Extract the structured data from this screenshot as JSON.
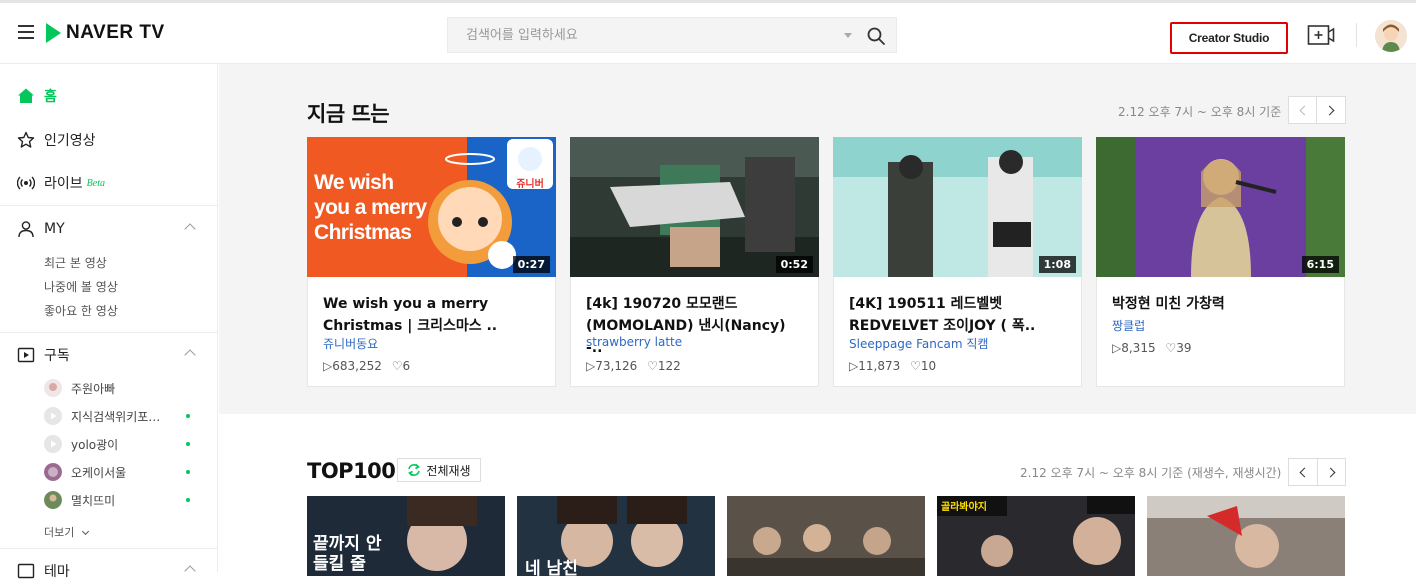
{
  "header": {
    "logo_text": "NAVER TV",
    "search_placeholder": "검색어를 입력하세요",
    "creator_studio_label": "Creator Studio",
    "accent_color": "#03c75a"
  },
  "sidebar": {
    "nav": [
      {
        "label": "홈",
        "icon": "home-icon",
        "active": true
      },
      {
        "label": "인기영상",
        "icon": "star-icon"
      },
      {
        "label": "라이브",
        "icon": "live-icon",
        "badge": "Beta"
      }
    ],
    "my": {
      "label": "MY",
      "items": [
        "최근 본 영상",
        "나중에 볼 영상",
        "좋아요 한 영상"
      ]
    },
    "subscriptions": {
      "label": "구독",
      "items": [
        {
          "name": "주원아빠",
          "new": false
        },
        {
          "name": "지식검색위키포…",
          "new": true
        },
        {
          "name": "yolo광이",
          "new": true
        },
        {
          "name": "오케이서울",
          "new": true
        },
        {
          "name": "멸치뜨미",
          "new": true
        }
      ],
      "more_label": "더보기"
    },
    "theme_label": "테마"
  },
  "trending": {
    "title": "지금 뜨는",
    "timestamp": "2.12 오후 7시 ~ 오후 8시 기준",
    "videos": [
      {
        "title": "We wish you a merry Christmas | 크리스마스 ..",
        "channel": "쥬니버동요",
        "views": "683,252",
        "likes": "6",
        "duration": "0:27",
        "thumb_text": [
          "We wish",
          "you a merry",
          "Christmas"
        ],
        "badge_text": "쥬니버"
      },
      {
        "title": "[4k] 190720 모모랜드(MOMOLAND) 낸시(Nancy) -..",
        "channel": "strawberry latte",
        "views": "73,126",
        "likes": "122",
        "duration": "0:52"
      },
      {
        "title": "[4K] 190511 레드벨벳 REDVELVET 조이JOY ( 폭..",
        "channel": "Sleeppage Fancam 직캠",
        "views": "11,873",
        "likes": "10",
        "duration": "1:08"
      },
      {
        "title": "박정현 미친 가창력",
        "channel": "짱클럽",
        "views": "8,315",
        "likes": "39",
        "duration": "6:15"
      }
    ]
  },
  "top100": {
    "title": "TOP100",
    "play_all_label": "전체재생",
    "timestamp": "2.12 오후 7시 ~ 오후 8시 기준 (재생수, 재생시간)",
    "thumbs": [
      {
        "caption": "끝까지 안 들킬 줄"
      },
      {
        "caption": "네 남친"
      },
      {
        "caption": ""
      },
      {
        "caption": "골라봐야지"
      },
      {
        "caption": ""
      }
    ]
  }
}
